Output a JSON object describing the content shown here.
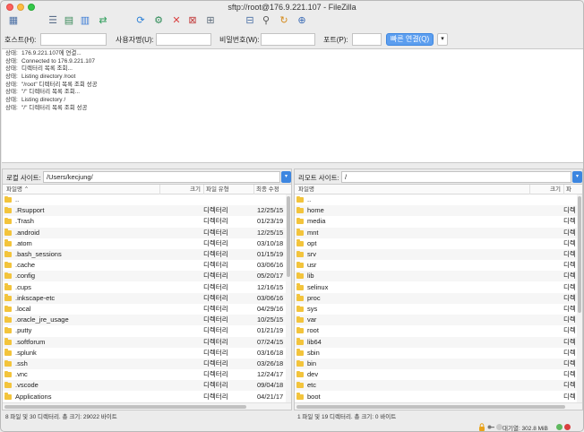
{
  "window": {
    "title": "sftp://root@176.9.221.107 - FileZilla"
  },
  "toolbar": {
    "buttons": [
      {
        "name": "site-manager",
        "glyph": "▦",
        "color": "#4a6fa5"
      },
      {
        "name": "toggle-log",
        "glyph": "☰",
        "color": "#5b6e8a"
      },
      {
        "name": "toggle-local-tree",
        "glyph": "▤",
        "color": "#3a8a5a"
      },
      {
        "name": "toggle-remote-tree",
        "glyph": "▥",
        "color": "#3a7bd5"
      },
      {
        "name": "transfer-queue",
        "glyph": "⇄",
        "color": "#2f9e5c"
      },
      {
        "name": "refresh",
        "glyph": "⟳",
        "color": "#2a7fd6"
      },
      {
        "name": "process-queue",
        "glyph": "⚙",
        "color": "#2e8b57"
      },
      {
        "name": "cancel",
        "glyph": "✕",
        "color": "#d94040"
      },
      {
        "name": "disconnect",
        "glyph": "⊠",
        "color": "#c23b3b"
      },
      {
        "name": "reconnect",
        "glyph": "⊞",
        "color": "#5c6b7a"
      },
      {
        "name": "directory-comparison",
        "glyph": "⊟",
        "color": "#4a6fa5"
      },
      {
        "name": "filter",
        "glyph": "⚲",
        "color": "#555555"
      },
      {
        "name": "sync-browse",
        "glyph": "↻",
        "color": "#d48a1a"
      },
      {
        "name": "search",
        "glyph": "⊕",
        "color": "#3a6ab5"
      }
    ]
  },
  "quickconnect": {
    "host_label": "호스트(H):",
    "user_label": "사용자명(U):",
    "pass_label": "비밀번호(W):",
    "port_label": "포트(P):",
    "host_value": "",
    "user_value": "",
    "pass_value": "",
    "port_value": "",
    "connect_label": "빠른 연결(Q)"
  },
  "log": {
    "lines": [
      {
        "status": "상태:",
        "text": "176.9.221.107에 연결..."
      },
      {
        "status": "상태:",
        "text": "Connected to 176.9.221.107"
      },
      {
        "status": "상태:",
        "text": "디렉터리 목록 조회..."
      },
      {
        "status": "상태:",
        "text": "Listing directory /root"
      },
      {
        "status": "상태:",
        "text": "\"/root\" 디렉터리 목록 조회 성공"
      },
      {
        "status": "상태:",
        "text": "\"/\" 디렉터리 목록 조회..."
      },
      {
        "status": "상태:",
        "text": "Listing directory /"
      },
      {
        "status": "상태:",
        "text": "\"/\" 디렉터리 목록 조회 성공"
      }
    ]
  },
  "local": {
    "site_label": "로컬 사이트:",
    "path": "/Users/kecjung/",
    "columns": {
      "name": "파일명",
      "size": "크기",
      "type": "파일 유형",
      "modified": "최종 수정"
    },
    "files": [
      {
        "name": "..",
        "type": "",
        "modified": ""
      },
      {
        "name": ".Rsupport",
        "type": "디렉터리",
        "modified": "12/25/15"
      },
      {
        "name": ".Trash",
        "type": "디렉터리",
        "modified": "01/23/19"
      },
      {
        "name": ".android",
        "type": "디렉터리",
        "modified": "12/25/15"
      },
      {
        "name": ".atom",
        "type": "디렉터리",
        "modified": "03/10/18"
      },
      {
        "name": ".bash_sessions",
        "type": "디렉터리",
        "modified": "01/15/19"
      },
      {
        "name": ".cache",
        "type": "디렉터리",
        "modified": "03/06/16"
      },
      {
        "name": ".config",
        "type": "디렉터리",
        "modified": "05/20/17"
      },
      {
        "name": ".cups",
        "type": "디렉터리",
        "modified": "12/16/15"
      },
      {
        "name": ".inkscape-etc",
        "type": "디렉터리",
        "modified": "03/06/16"
      },
      {
        "name": ".local",
        "type": "디렉터리",
        "modified": "04/29/16"
      },
      {
        "name": ".oracle_jre_usage",
        "type": "디렉터리",
        "modified": "10/25/15"
      },
      {
        "name": ".putty",
        "type": "디렉터리",
        "modified": "01/21/19"
      },
      {
        "name": ".softforum",
        "type": "디렉터리",
        "modified": "07/24/15"
      },
      {
        "name": ".splunk",
        "type": "디렉터리",
        "modified": "03/16/18"
      },
      {
        "name": ".ssh",
        "type": "디렉터리",
        "modified": "03/26/18"
      },
      {
        "name": ".vnc",
        "type": "디렉터리",
        "modified": "12/24/17"
      },
      {
        "name": ".vscode",
        "type": "디렉터리",
        "modified": "09/04/18"
      },
      {
        "name": "Applications",
        "type": "디렉터리",
        "modified": "04/21/17"
      }
    ],
    "status": "8 파일 및 30 디렉터리. 총 크기: 29022 바이트"
  },
  "remote": {
    "site_label": "리모트 사이트:",
    "path": "/",
    "columns": {
      "name": "파일명",
      "size": "크기",
      "type": "파"
    },
    "files": [
      {
        "name": "..",
        "type": ""
      },
      {
        "name": "home",
        "type": "디렉"
      },
      {
        "name": "media",
        "type": "디렉"
      },
      {
        "name": "mnt",
        "type": "디렉"
      },
      {
        "name": "opt",
        "type": "디렉"
      },
      {
        "name": "srv",
        "type": "디렉"
      },
      {
        "name": "usr",
        "type": "디렉"
      },
      {
        "name": "lib",
        "type": "디렉"
      },
      {
        "name": "selinux",
        "type": "디렉"
      },
      {
        "name": "proc",
        "type": "디렉"
      },
      {
        "name": "sys",
        "type": "디렉"
      },
      {
        "name": "var",
        "type": "디렉"
      },
      {
        "name": "root",
        "type": "디렉"
      },
      {
        "name": "lib64",
        "type": "디렉"
      },
      {
        "name": "sbin",
        "type": "디렉"
      },
      {
        "name": "bin",
        "type": "디렉"
      },
      {
        "name": "dev",
        "type": "디렉"
      },
      {
        "name": "etc",
        "type": "디렉"
      },
      {
        "name": "boot",
        "type": "디렉"
      }
    ],
    "status": "1 파일 및 19 디렉터리. 총 크기: 0 바이트"
  },
  "bottombar": {
    "queue": "대기열: 302.8 MiB"
  }
}
